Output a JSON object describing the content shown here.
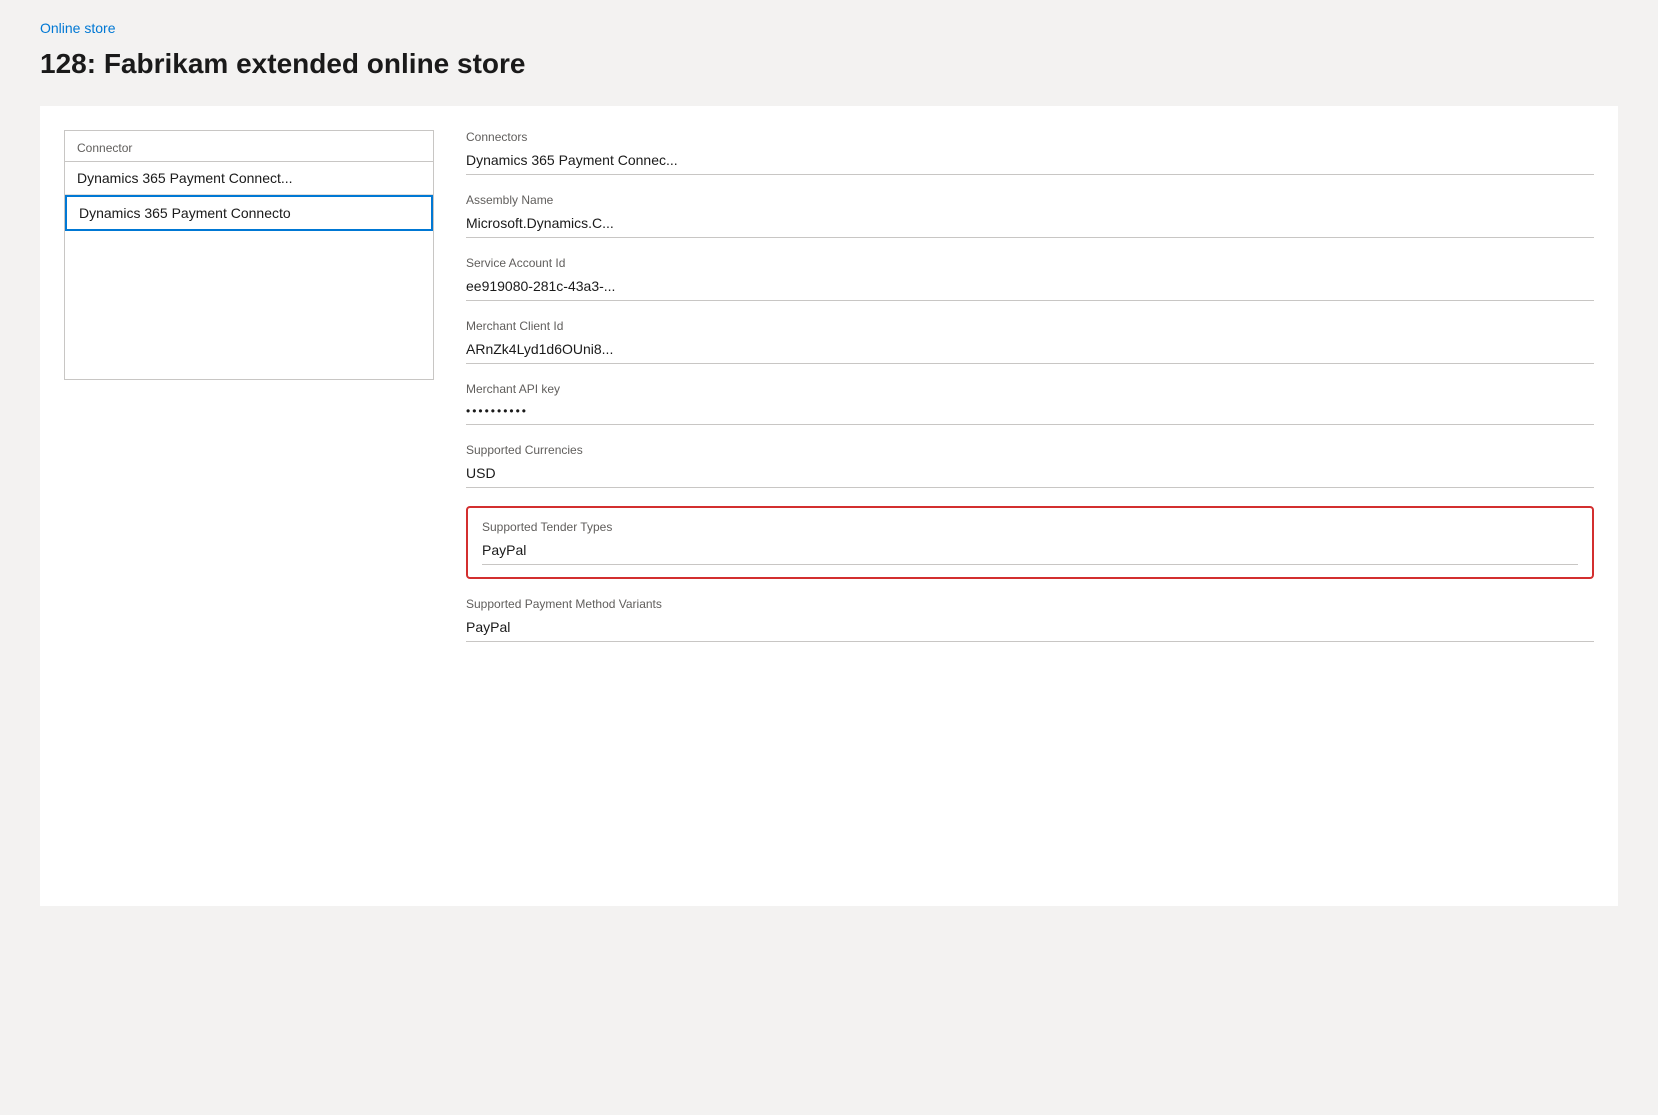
{
  "breadcrumb": {
    "label": "Online store"
  },
  "page": {
    "title": "128: Fabrikam extended online store"
  },
  "left_panel": {
    "connector_list": {
      "header": "Connector",
      "items": [
        {
          "id": "item-1",
          "label": "Dynamics 365 Payment Connect...",
          "selected": false
        },
        {
          "id": "item-2",
          "label": "Dynamics 365 Payment Connecto",
          "selected": true
        }
      ]
    }
  },
  "right_panel": {
    "fields": [
      {
        "id": "connectors",
        "label": "Connectors",
        "value": "Dynamics 365 Payment Connec...",
        "highlighted": false
      },
      {
        "id": "assembly-name",
        "label": "Assembly Name",
        "value": "Microsoft.Dynamics.C...",
        "highlighted": false
      },
      {
        "id": "service-account-id",
        "label": "Service Account Id",
        "value": "ee919080-281c-43a3-...",
        "highlighted": false
      },
      {
        "id": "merchant-client-id",
        "label": "Merchant Client Id",
        "value": "ARnZk4Lyd1d6OUni8...",
        "highlighted": false
      },
      {
        "id": "merchant-api-key",
        "label": "Merchant API key",
        "value": "••••••••••",
        "highlighted": false,
        "is_password": true
      },
      {
        "id": "supported-currencies",
        "label": "Supported Currencies",
        "value": "USD",
        "highlighted": false
      },
      {
        "id": "supported-tender-types",
        "label": "Supported Tender Types",
        "value": "PayPal",
        "highlighted": true
      },
      {
        "id": "supported-payment-method-variants",
        "label": "Supported Payment Method Variants",
        "value": "PayPal",
        "highlighted": false
      }
    ]
  }
}
